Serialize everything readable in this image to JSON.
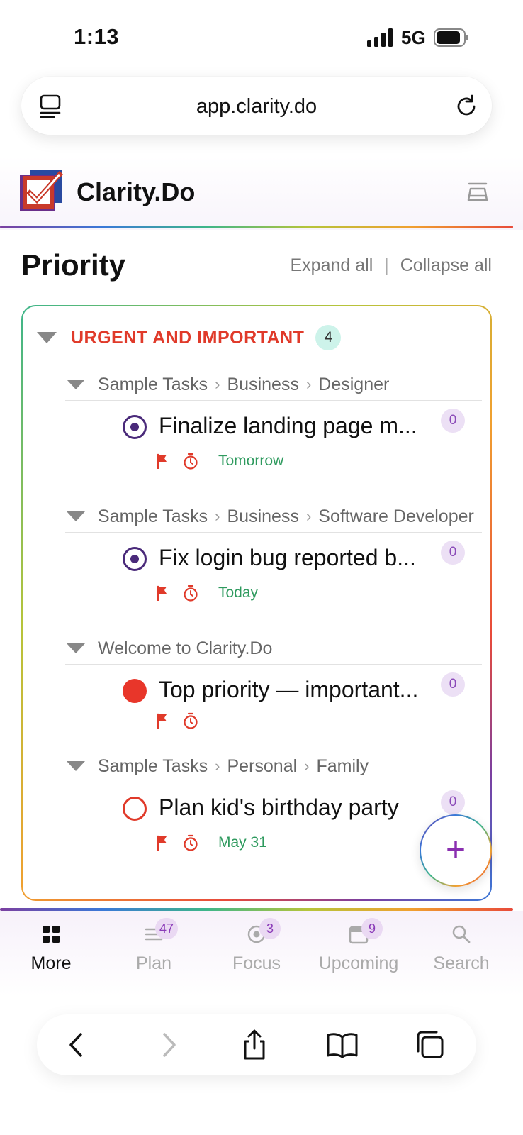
{
  "status_bar": {
    "time": "1:13",
    "network": "5G"
  },
  "browser": {
    "url": "app.clarity.do"
  },
  "app": {
    "title": "Clarity.Do"
  },
  "page": {
    "title": "Priority",
    "expand_all": "Expand all",
    "separator": "|",
    "collapse_all": "Collapse all"
  },
  "group": {
    "label": "URGENT AND IMPORTANT",
    "count": "4",
    "sections": [
      {
        "crumbs": [
          "Sample Tasks",
          "Business",
          "Designer"
        ],
        "task": {
          "title": "Finalize landing page m...",
          "badge": "0",
          "due": "Tomorrow",
          "status": "in-progress"
        }
      },
      {
        "crumbs": [
          "Sample Tasks",
          "Business",
          "Software Developer"
        ],
        "task": {
          "title": "Fix login bug reported b...",
          "badge": "0",
          "due": "Today",
          "status": "in-progress"
        }
      },
      {
        "crumbs": [
          "Welcome to Clarity.Do"
        ],
        "task": {
          "title": "Top priority — important...",
          "badge": "0",
          "due": "",
          "status": "top-priority"
        }
      },
      {
        "crumbs": [
          "Sample Tasks",
          "Personal",
          "Family"
        ],
        "task": {
          "title": "Plan kid's birthday party",
          "badge": "0",
          "due": "May 31",
          "status": "open"
        }
      }
    ]
  },
  "fab": {
    "symbol": "+"
  },
  "nav": {
    "items": [
      {
        "label": "More",
        "badge": "",
        "icon": "grid-icon"
      },
      {
        "label": "Plan",
        "badge": "47",
        "icon": "list-icon"
      },
      {
        "label": "Focus",
        "badge": "3",
        "icon": "target-icon"
      },
      {
        "label": "Upcoming",
        "badge": "9",
        "icon": "calendar-icon"
      },
      {
        "label": "Search",
        "badge": "",
        "icon": "search-icon"
      }
    ]
  },
  "colors": {
    "urgent_red": "#e03a2a",
    "due_green": "#2e9a5e",
    "accent_purple": "#8a2fb0",
    "check_purple": "#4a2a7a"
  }
}
